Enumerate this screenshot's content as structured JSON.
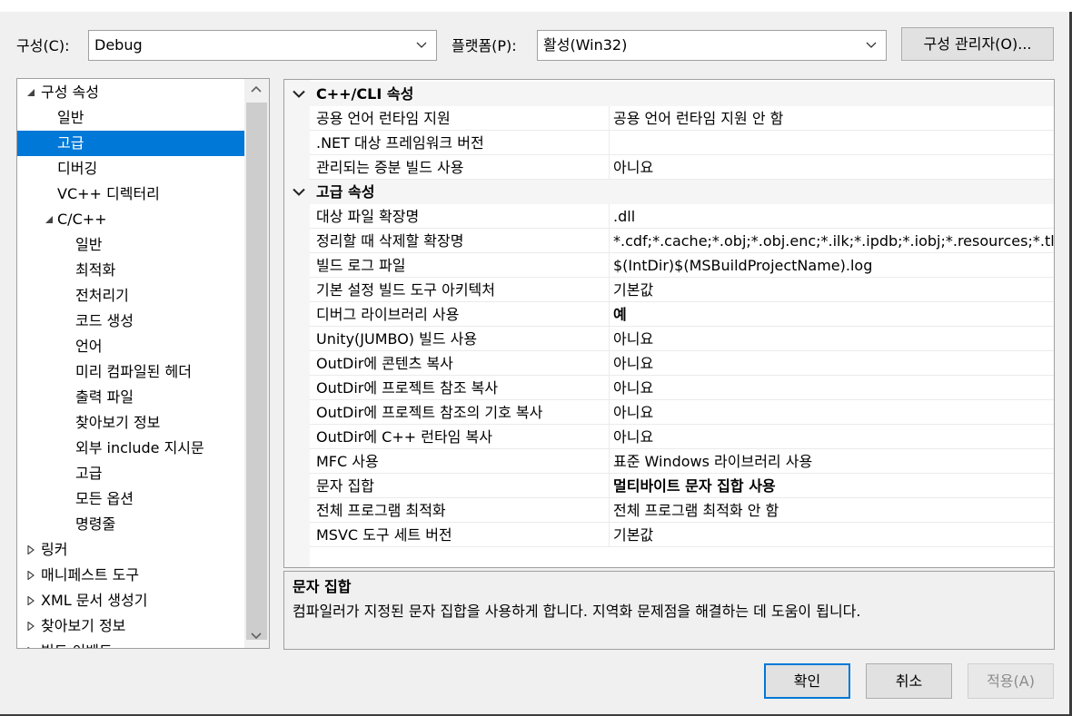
{
  "config": {
    "config_label": "구성(C):",
    "config_value": "Debug",
    "platform_label": "플랫폼(P):",
    "platform_value": "활성(Win32)",
    "manager_button": "구성 관리자(O)..."
  },
  "tree": {
    "items": [
      {
        "label": "구성 속성",
        "level": 0,
        "twisty": "expanded"
      },
      {
        "label": "일반",
        "level": 1,
        "twisty": ""
      },
      {
        "label": "고급",
        "level": 1,
        "twisty": "",
        "selected": true
      },
      {
        "label": "디버깅",
        "level": 1,
        "twisty": ""
      },
      {
        "label": "VC++ 디렉터리",
        "level": 1,
        "twisty": ""
      },
      {
        "label": "C/C++",
        "level": 1,
        "twisty": "expanded"
      },
      {
        "label": "일반",
        "level": 2,
        "twisty": ""
      },
      {
        "label": "최적화",
        "level": 2,
        "twisty": ""
      },
      {
        "label": "전처리기",
        "level": 2,
        "twisty": ""
      },
      {
        "label": "코드 생성",
        "level": 2,
        "twisty": ""
      },
      {
        "label": "언어",
        "level": 2,
        "twisty": ""
      },
      {
        "label": "미리 컴파일된 헤더",
        "level": 2,
        "twisty": ""
      },
      {
        "label": "출력 파일",
        "level": 2,
        "twisty": ""
      },
      {
        "label": "찾아보기 정보",
        "level": 2,
        "twisty": ""
      },
      {
        "label": "외부 include 지시문",
        "level": 2,
        "twisty": ""
      },
      {
        "label": "고급",
        "level": 2,
        "twisty": ""
      },
      {
        "label": "모든 옵션",
        "level": 2,
        "twisty": ""
      },
      {
        "label": "명령줄",
        "level": 2,
        "twisty": ""
      },
      {
        "label": "링커",
        "level": 0,
        "twisty": "collapsed"
      },
      {
        "label": "매니페스트 도구",
        "level": 0,
        "twisty": "collapsed"
      },
      {
        "label": "XML 문서 생성기",
        "level": 0,
        "twisty": "collapsed"
      },
      {
        "label": "찾아보기 정보",
        "level": 0,
        "twisty": "collapsed"
      },
      {
        "label": "빌드 이벤트",
        "level": 0,
        "twisty": "collapsed"
      }
    ]
  },
  "grid": {
    "sections": [
      {
        "title": "C++/CLI 속성",
        "rows": [
          {
            "name": "공용 언어 런타임 지원",
            "value": "공용 언어 런타임 지원 안 함"
          },
          {
            "name": ".NET 대상 프레임워크 버전",
            "value": ""
          },
          {
            "name": "관리되는 증분 빌드 사용",
            "value": "아니요"
          }
        ]
      },
      {
        "title": "고급 속성",
        "rows": [
          {
            "name": "대상 파일 확장명",
            "value": ".dll"
          },
          {
            "name": "정리할 때 삭제할 확장명",
            "value": "*.cdf;*.cache;*.obj;*.obj.enc;*.ilk;*.ipdb;*.iobj;*.resources;*.tlb;"
          },
          {
            "name": "빌드 로그 파일",
            "value": "$(IntDir)$(MSBuildProjectName).log"
          },
          {
            "name": "기본 설정 빌드 도구 아키텍처",
            "value": "기본값"
          },
          {
            "name": "디버그 라이브러리 사용",
            "value": "예",
            "bold": true
          },
          {
            "name": "Unity(JUMBO) 빌드 사용",
            "value": "아니요"
          },
          {
            "name": "OutDir에 콘텐츠 복사",
            "value": "아니요"
          },
          {
            "name": "OutDir에 프로젝트 참조 복사",
            "value": "아니요"
          },
          {
            "name": "OutDir에 프로젝트 참조의 기호 복사",
            "value": "아니요"
          },
          {
            "name": "OutDir에 C++ 런타임 복사",
            "value": "아니요"
          },
          {
            "name": "MFC 사용",
            "value": "표준 Windows 라이브러리 사용"
          },
          {
            "name": "문자 집합",
            "value": "멀티바이트 문자 집합 사용",
            "bold": true
          },
          {
            "name": "전체 프로그램 최적화",
            "value": "전체 프로그램 최적화 안 함"
          },
          {
            "name": "MSVC 도구 세트 버전",
            "value": "기본값"
          }
        ]
      }
    ]
  },
  "description": {
    "title": "문자 집합",
    "text": "컴파일러가 지정된 문자 집합을 사용하게 합니다. 지역화 문제점을 해결하는 데 도움이 됩니다."
  },
  "buttons": {
    "ok": "확인",
    "cancel": "취소",
    "apply": "적용(A)"
  },
  "icons": {
    "dropdown": "chevron-down-icon",
    "expanded": "triangle-expanded-icon",
    "collapsed": "triangle-collapsed-icon",
    "scroll_up": "scroll-up-icon",
    "scroll_down": "scroll-down-icon",
    "section": "section-chevron-icon"
  },
  "colors": {
    "selection": "#0078d7",
    "default_button_border": "#0078d7"
  }
}
